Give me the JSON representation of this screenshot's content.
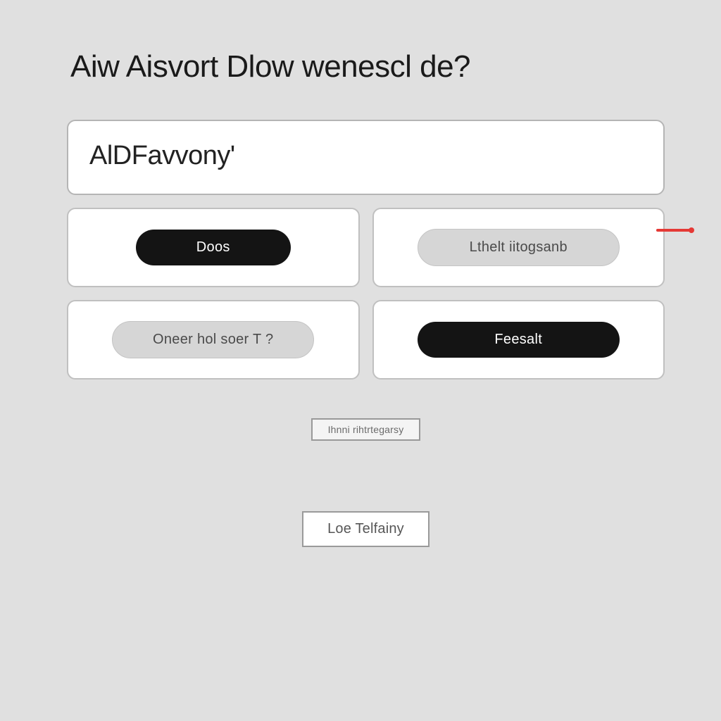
{
  "header": {
    "title": "Aiw Aisvort Dlow wenescl de?"
  },
  "search": {
    "value": "AlDFavvony'"
  },
  "options": {
    "row1": [
      {
        "label": "Doos",
        "variant": "dark"
      },
      {
        "label": "Lthelt iitogsanb",
        "variant": "light"
      }
    ],
    "row2": [
      {
        "label": "Oneer hol soer T  ?",
        "variant": "light"
      },
      {
        "label": "Feesalt",
        "variant": "dark"
      }
    ]
  },
  "actions": {
    "small_label": "Ihnni rihtrtegarsy",
    "bottom_label": "Loe Telfainy"
  }
}
